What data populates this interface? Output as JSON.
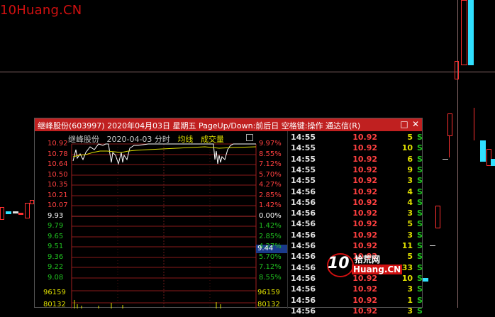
{
  "background": {
    "watermark": "10Huang.CN"
  },
  "dialog": {
    "title": "继峰股份(603997) 2020年04月03日 星期五 PageUp/Down:前后日 空格键:操作 通达信(R)",
    "minimize_icon": "restore-icon",
    "close_icon": "close-icon",
    "chart": {
      "stock_name": "继峰股份",
      "date_label": "2020-04-03 分时",
      "ma_label": "均线",
      "vol_label": "成交量",
      "left_axis": [
        "10.92",
        "10.78",
        "10.64",
        "10.50",
        "10.35",
        "10.21",
        "10.07",
        "9.93",
        "9.79",
        "9.65",
        "9.51",
        "9.36",
        "9.22",
        "9.08"
      ],
      "right_axis": [
        "9.97%",
        "8.55%",
        "7.12%",
        "5.70%",
        "4.27%",
        "2.85%",
        "1.42%",
        "0.00%",
        "1.42%",
        "2.85%",
        "4.27%",
        "5.70%",
        "7.12%",
        "8.55%"
      ],
      "volume_left": [
        "96159",
        "80132"
      ],
      "volume_right": [
        "96159",
        "80132"
      ],
      "cursor_value": "9.44"
    },
    "trades": [
      {
        "time": "14:55",
        "price": "10.92",
        "vol": "5",
        "side": "S"
      },
      {
        "time": "14:55",
        "price": "10.92",
        "vol": "10",
        "side": "S"
      },
      {
        "time": "14:55",
        "price": "10.92",
        "vol": "6",
        "side": "S"
      },
      {
        "time": "14:55",
        "price": "10.92",
        "vol": "9",
        "side": "S"
      },
      {
        "time": "14:55",
        "price": "10.92",
        "vol": "3",
        "side": "S"
      },
      {
        "time": "14:56",
        "price": "10.92",
        "vol": "4",
        "side": "S"
      },
      {
        "time": "14:56",
        "price": "10.92",
        "vol": "4",
        "side": "S"
      },
      {
        "time": "14:56",
        "price": "10.92",
        "vol": "3",
        "side": "S"
      },
      {
        "time": "14:56",
        "price": "10.92",
        "vol": "5",
        "side": "S"
      },
      {
        "time": "14:56",
        "price": "10.92",
        "vol": "3",
        "side": "S"
      },
      {
        "time": "14:56",
        "price": "10.92",
        "vol": "11",
        "side": "S"
      },
      {
        "time": "14:56",
        "price": "10.92",
        "vol": "5",
        "side": "S"
      },
      {
        "time": "14:56",
        "price": "10.92",
        "vol": "33",
        "side": "S"
      },
      {
        "time": "14:56",
        "price": "10.92",
        "vol": "10",
        "side": "S"
      },
      {
        "time": "14:56",
        "price": "10.92",
        "vol": "3",
        "side": "S"
      },
      {
        "time": "14:56",
        "price": "10.92",
        "vol": "1",
        "side": "S"
      },
      {
        "time": "14:56",
        "price": "10.92",
        "vol": "3",
        "side": "S"
      }
    ]
  },
  "logo": {
    "number": "10",
    "cn_text": "拾荒网",
    "latin_text": "Huang.CN"
  },
  "colors": {
    "title_bar": "#c02020",
    "up": "#ff4040",
    "down": "#20c020",
    "cyan_candle": "#30e0ff",
    "volume": "#e0e000"
  }
}
